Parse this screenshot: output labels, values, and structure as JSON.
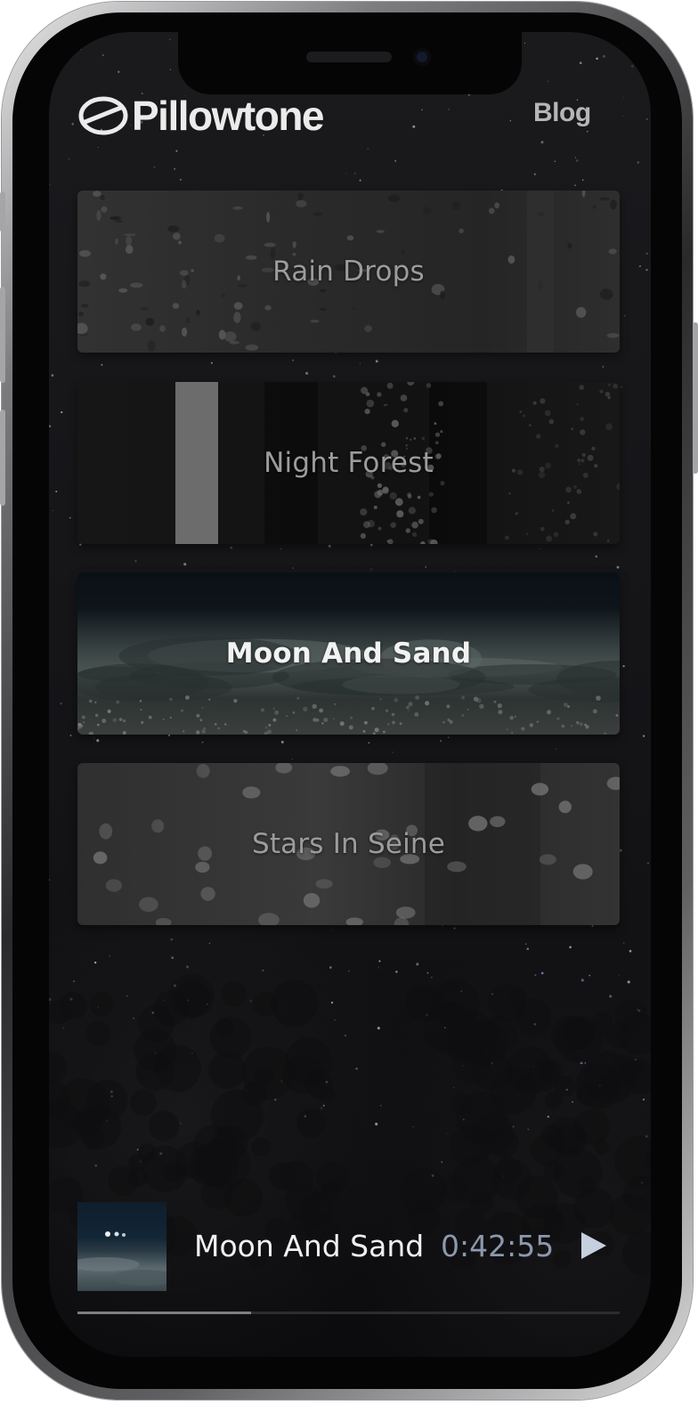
{
  "brand": {
    "name": "Pillowtone",
    "icon": "pill-logo-icon"
  },
  "nav": {
    "blog_label": "Blog"
  },
  "tracks": [
    {
      "title": "Rain Drops",
      "active": false
    },
    {
      "title": "Night Forest",
      "active": false
    },
    {
      "title": "Moon And Sand",
      "active": true
    },
    {
      "title": "Stars In Seine",
      "active": false
    }
  ],
  "player": {
    "current_title": "Moon And Sand",
    "time": "0:42:55",
    "play_icon": "play-icon",
    "progress": 0.32
  },
  "colors": {
    "background": "#141417",
    "time_text": "#8c98ad",
    "active_title": "#f2f2f2",
    "inactive_title": "#9c9c9c"
  }
}
